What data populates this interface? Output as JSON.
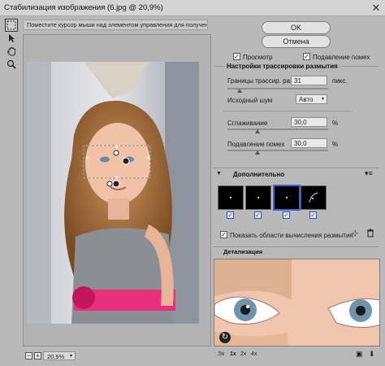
{
  "window": {
    "title": "Стабилизация изображения (6.jpg @ 20,9%)"
  },
  "toolbar": {
    "tools": [
      {
        "icon": "marquee-icon",
        "selected": true
      },
      {
        "icon": "arrow-cursor-icon",
        "selected": false
      },
      {
        "icon": "hand-icon",
        "selected": false
      },
      {
        "icon": "zoom-icon",
        "selected": false
      }
    ]
  },
  "hint": {
    "text": "Поместите курсор мыши над элементом управления для получения справки."
  },
  "zoom": {
    "value": "20,9%",
    "minus_label": "−",
    "plus_label": "+"
  },
  "buttons": {
    "ok": "OK",
    "cancel": "Отмена"
  },
  "options": {
    "preview_label": "Просмотр",
    "preview_checked": true,
    "suppress_noise_label": "Подавление помех",
    "suppress_noise_checked": true
  },
  "tracing": {
    "header": "Настройки трассировки размытия",
    "bounds_label": "Границы трассир. размытия:",
    "bounds_value": "31",
    "bounds_unit": "пикс.",
    "bounds_level": 0.12,
    "noise_label": "Исходный шум",
    "noise_value": "Авто",
    "smoothing_label": "Сглаживание",
    "smoothing_value": "30,0",
    "smoothing_unit": "%",
    "smoothing_level": 0.3,
    "suppress_label": "Подавление помех",
    "suppress_value": "30,0",
    "suppress_unit": "%",
    "suppress_level": 0.3
  },
  "advanced": {
    "header": "Дополнительно",
    "thumbnails": [
      {
        "checked": true,
        "selected": false
      },
      {
        "checked": true,
        "selected": false
      },
      {
        "checked": true,
        "selected": true
      },
      {
        "checked": true,
        "selected": false
      }
    ],
    "show_regions_label": "Показать области вычисления размытия",
    "show_regions_checked": true
  },
  "detail": {
    "header": "Детализация",
    "magnifications": [
      ".5x",
      "1x",
      "2x",
      "4x"
    ],
    "selected_magnification": "1x"
  },
  "colors": {
    "panel_bg": "#b9b9b9",
    "selection_blue": "#3d63d8",
    "skirt_pink": "#e8307a"
  }
}
